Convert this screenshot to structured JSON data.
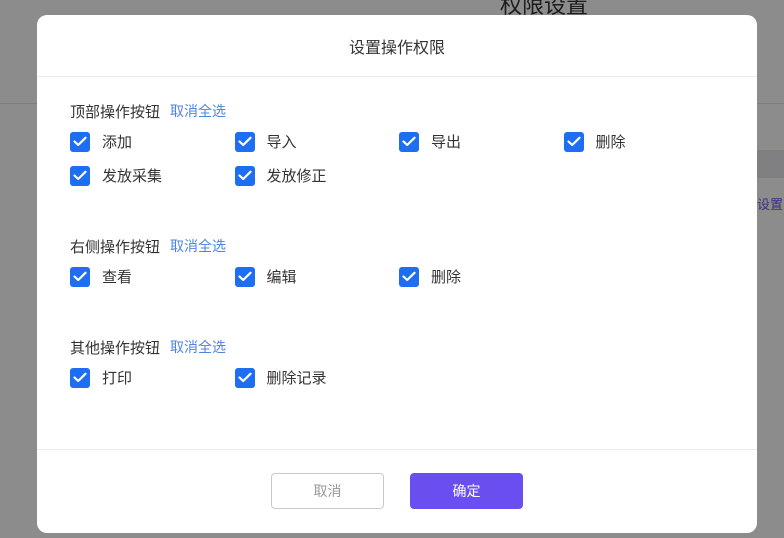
{
  "background": {
    "title": "权限设置",
    "side_link": "设置"
  },
  "dialog": {
    "title": "设置操作权限",
    "sections": [
      {
        "title": "顶部操作按钮",
        "select_all": "取消全选",
        "options": [
          {
            "label": "添加",
            "checked": true
          },
          {
            "label": "导入",
            "checked": true
          },
          {
            "label": "导出",
            "checked": true
          },
          {
            "label": "删除",
            "checked": true
          },
          {
            "label": "发放采集",
            "checked": true
          },
          {
            "label": "发放修正",
            "checked": true
          }
        ]
      },
      {
        "title": "右侧操作按钮",
        "select_all": "取消全选",
        "options": [
          {
            "label": "查看",
            "checked": true
          },
          {
            "label": "编辑",
            "checked": true
          },
          {
            "label": "删除",
            "checked": true
          }
        ]
      },
      {
        "title": "其他操作按钮",
        "select_all": "取消全选",
        "options": [
          {
            "label": "打印",
            "checked": true
          },
          {
            "label": "删除记录",
            "checked": true
          }
        ]
      }
    ],
    "buttons": {
      "cancel": "取消",
      "confirm": "确定"
    }
  },
  "colors": {
    "checkbox": "#1d6ef2",
    "link": "#4e83e6",
    "confirm": "#6b4ef0"
  }
}
